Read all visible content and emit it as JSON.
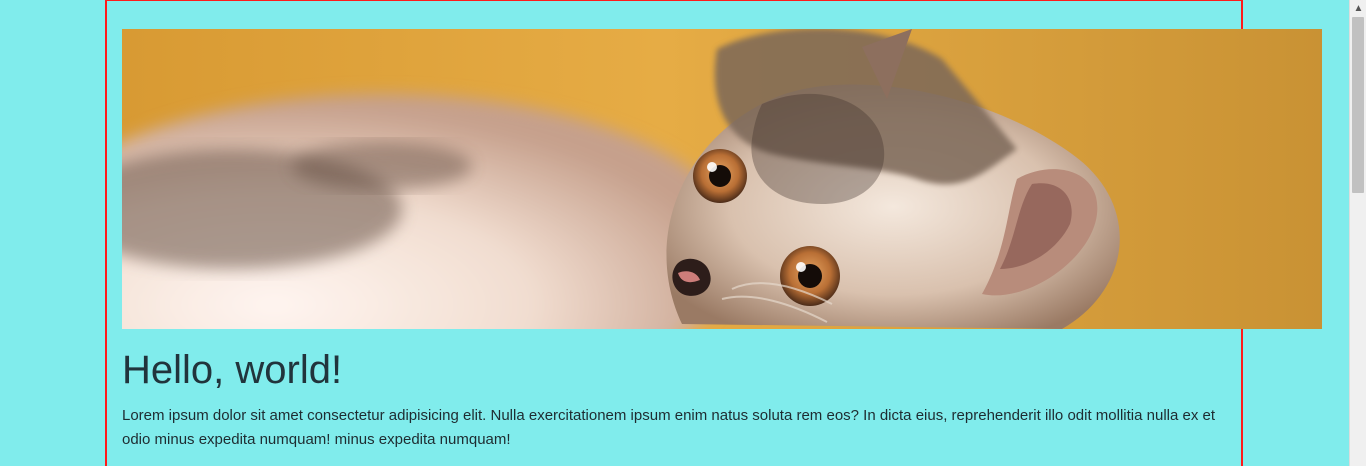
{
  "hero": {
    "alt": "Kitten lying on a bed"
  },
  "content": {
    "title": "Hello, world!",
    "paragraph": "Lorem ipsum dolor sit amet consectetur adipisicing elit. Nulla exercitationem ipsum enim natus soluta rem eos? In dicta eius, reprehenderit illo odit mollitia nulla ex et odio minus expedita numquam! minus expedita numquam!"
  },
  "scrollbar": {
    "up_icon": "chevron-up-icon"
  },
  "colors": {
    "page_background": "#80ecec",
    "container_border": "#ff1a1a",
    "title_text": "#21343c",
    "body_text": "#1e2c31"
  }
}
